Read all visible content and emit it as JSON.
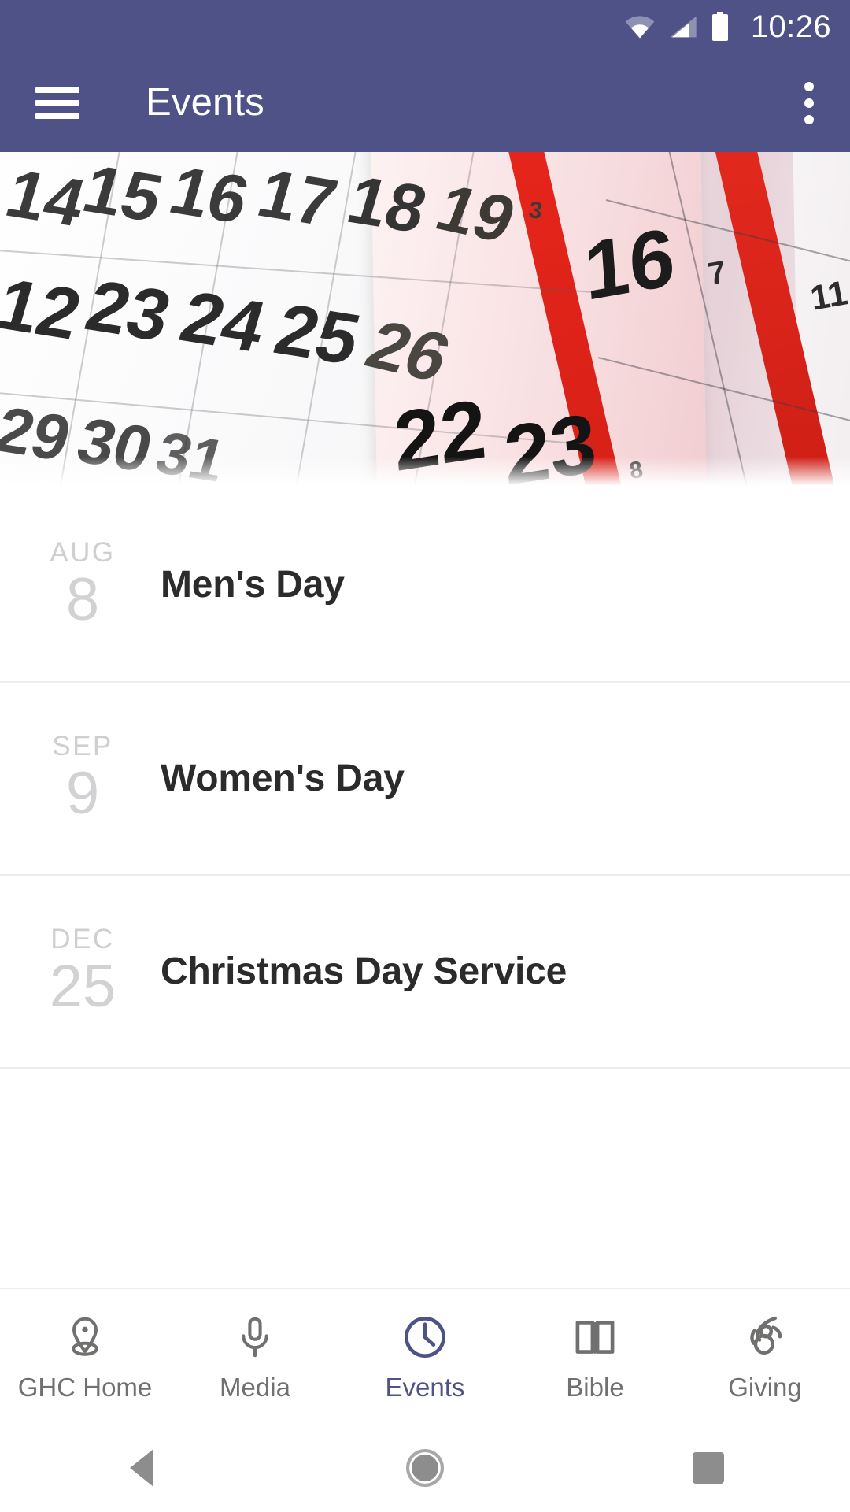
{
  "statusbar": {
    "time": "10:26",
    "icons": [
      "wifi-icon",
      "cellular-signal-icon",
      "battery-icon"
    ]
  },
  "appbar": {
    "title": "Events",
    "menu_icon": "hamburger-menu-icon",
    "overflow_icon": "overflow-menu-icon",
    "background_color": "#4f5287"
  },
  "hero": {
    "alt": "calendar-pages-photo",
    "numbers": [
      "14",
      "15",
      "16",
      "17",
      "18",
      "19",
      "22",
      "23",
      "24",
      "25",
      "26",
      "29",
      "30",
      "31",
      "3",
      "16",
      "7",
      "11",
      "22",
      "23"
    ]
  },
  "events": [
    {
      "month": "AUG",
      "day": "8",
      "title": "Men's Day"
    },
    {
      "month": "SEP",
      "day": "9",
      "title": "Women's Day"
    },
    {
      "month": "DEC",
      "day": "25",
      "title": "Christmas Day Service"
    }
  ],
  "bottom_nav": {
    "active_color": "#4f5287",
    "inactive_color": "#70706f",
    "items": [
      {
        "label": "GHC Home",
        "icon": "location-pin-icon",
        "active": false
      },
      {
        "label": "Media",
        "icon": "microphone-icon",
        "active": false
      },
      {
        "label": "Events",
        "icon": "clock-icon",
        "active": true
      },
      {
        "label": "Bible",
        "icon": "open-book-icon",
        "active": false
      },
      {
        "label": "Giving",
        "icon": "giving-hands-icon",
        "active": false
      }
    ]
  },
  "system_nav": {
    "back": "back-triangle-icon",
    "home": "home-circle-icon",
    "recents": "recents-square-icon"
  }
}
